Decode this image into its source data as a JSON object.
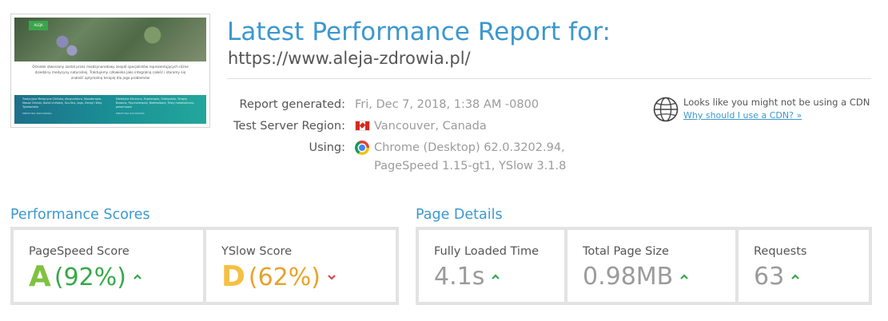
{
  "colors": {
    "accent": "#3c98cf",
    "grade_a": "#7fc241",
    "grade_d": "#f5c044",
    "up": "#2fa84a",
    "down": "#e0424f"
  },
  "thumbnail": {
    "logo": "ALEJA",
    "text": "Ośrodek stworzony został przez międzynarodowy zespół specjalistów reprezentujących różne dziedziny medycyny naturalnej. Traktujemy człowieka jako integralną całość i staramy się znaleźć optymalną terapię dla jego problemów",
    "col1": "Tradycyjna Medycyna Chińska, Akupunktura, Moxoterapia, Masaż Chiński, Bańki chińskie, Szu-Sha, Joga, Zenigi i Wizy Tybetańskie",
    "col1_tag": "MEDYCYNA WSCHODNIA",
    "col2": "Dietetyka Kliniczna, Fizjoterapia, Osteopatia, Terapia Bowena, Psychoterapia, Biofeedback, Testy metaboliczno-pokarmowe",
    "col2_tag": "MEDYCYNA ZACHODNIA"
  },
  "header": {
    "title": "Latest Performance Report for:",
    "url": "https://www.aleja-zdrowia.pl/"
  },
  "info": {
    "generated_label": "Report generated:",
    "generated_value": "Fri, Dec 7, 2018, 1:38 AM -0800",
    "region_label": "Test Server Region:",
    "region_value": "Vancouver, Canada",
    "using_label": "Using:",
    "using_value_1": "Chrome (Desktop) 62.0.3202.94,",
    "using_value_2": "PageSpeed 1.15-gt1, YSlow 3.1.8",
    "flag_icon": "canada-flag-icon",
    "browser_icon": "chrome-icon"
  },
  "cdn": {
    "icon": "globe-icon",
    "text": "Looks like you might not be using a CDN",
    "link": "Why should I use a CDN? »"
  },
  "performance": {
    "title": "Performance Scores",
    "pagespeed": {
      "label": "PageSpeed Score",
      "grade": "A",
      "percent": "(92%)",
      "trend": "up"
    },
    "yslow": {
      "label": "YSlow Score",
      "grade": "D",
      "percent": "(62%)",
      "trend": "down"
    }
  },
  "details": {
    "title": "Page Details",
    "load_time": {
      "label": "Fully Loaded Time",
      "value": "4.1s",
      "trend": "up"
    },
    "page_size": {
      "label": "Total Page Size",
      "value": "0.98MB",
      "trend": "up"
    },
    "requests": {
      "label": "Requests",
      "value": "63",
      "trend": "up"
    }
  }
}
